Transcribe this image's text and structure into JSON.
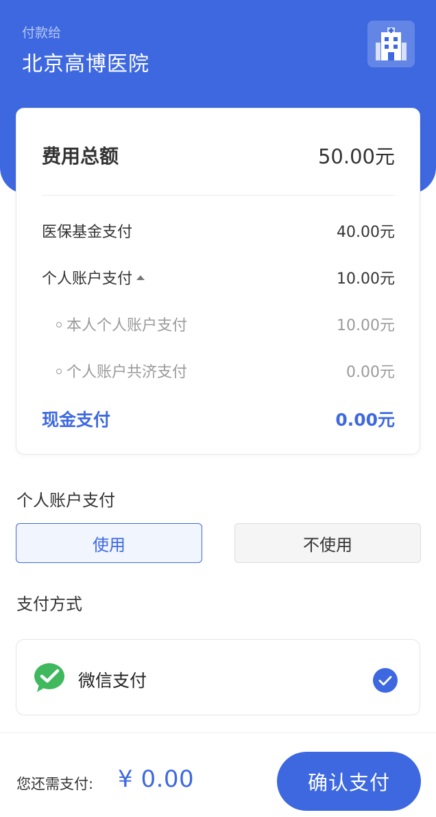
{
  "header": {
    "payee_caption": "付款给",
    "payee_name": "北京高博医院",
    "icon": "hospital-building-icon"
  },
  "summary": {
    "total_label": "费用总额",
    "total_amount": "50.00元",
    "lines": [
      {
        "label": "医保基金支付",
        "amount": "40.00元"
      },
      {
        "label": "个人账户支付",
        "amount": "10.00元",
        "expanded": true
      },
      {
        "label": "本人个人账户支付",
        "amount": "10.00元"
      },
      {
        "label": "个人账户共济支付",
        "amount": "0.00元"
      },
      {
        "label": "现金支付",
        "amount": "0.00元"
      }
    ]
  },
  "personal_account": {
    "title": "个人账户支付",
    "use_label": "使用",
    "not_use_label": "不使用",
    "selected": "使用"
  },
  "payment_method": {
    "title": "支付方式",
    "name": "微信支付",
    "icon": "wechat-pay-icon",
    "selected": true
  },
  "footer": {
    "due_label": "您还需支付:",
    "due_amount": "¥ 0.00",
    "confirm_label": "确认支付"
  },
  "colors": {
    "accent": "#3d68e0",
    "wechat_green": "#3fb85e"
  }
}
